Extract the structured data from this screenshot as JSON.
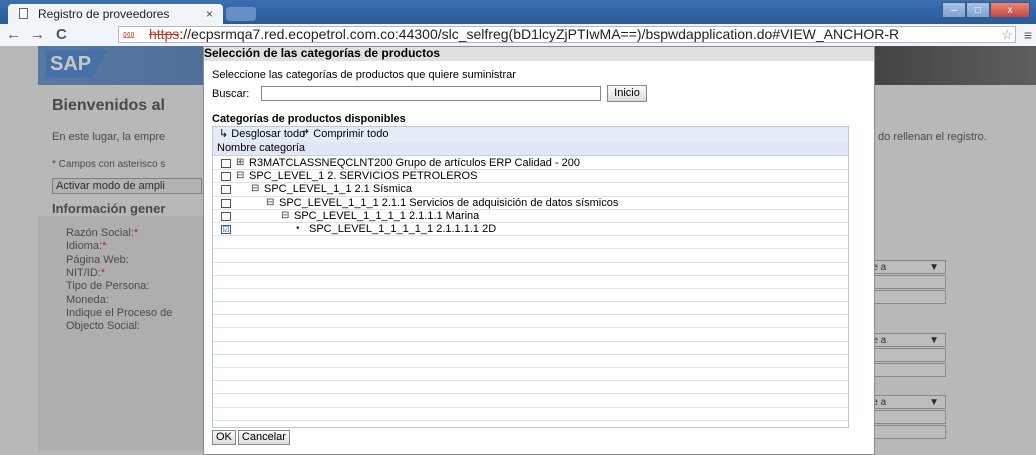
{
  "browser": {
    "tab_title": "Registro de proveedores",
    "tab_close": "×",
    "url_scheme": "https",
    "url_rest": "://ecpsrmqa7.red.ecopetrol.com.co:44300/slc_selfreg(bD1lcyZjPTIwMA==)/bspwdapplication.do#VIEW_ANCHOR-R",
    "back": "←",
    "forward": "→",
    "reload": "C",
    "menu": "≡",
    "star": "☆",
    "lock": "⅏",
    "win_min": "–",
    "win_max": "□",
    "win_close": "x"
  },
  "background": {
    "logo": "SAP",
    "heading": "Bienvenidos al",
    "intro": "En este lugar, la empre",
    "intro_right": "do rellenan el registro.",
    "required_note": "* Campos con asterisco s",
    "activar": "Activar modo de ampli",
    "info_heading": "Información gener",
    "fields": [
      "Razón Social:",
      "Idioma:",
      "Página Web:",
      "NIT/ID:",
      "Tipo de Persona:",
      "Moneda:",
      "Indique el Proceso de",
      "Objecto Social:"
    ],
    "required_marks": [
      true,
      true,
      false,
      true,
      false,
      false,
      false,
      false
    ],
    "right_selects": [
      "nte a",
      "nte a",
      "nte a"
    ],
    "select_arrow": "▼"
  },
  "modal": {
    "title": "Selección de las categorías de productos",
    "instruction": "Seleccione las categorías de productos que quiere suministrar",
    "search_label": "Buscar:",
    "search_value": "",
    "search_button": "Inicio",
    "categories_title": "Categorías de productos disponibles",
    "expand_all": "↳ Desglosar todo",
    "collapse_all": "↱ Comprimir todo",
    "column_header": "Nombre categoría",
    "rows": [
      {
        "indent": 0,
        "expander": "⊞",
        "label": "R3MATCLASSNEQCLNT200 Grupo de artículos ERP Calidad - 200",
        "checked": false
      },
      {
        "indent": 0,
        "expander": "⊟",
        "label": "SPC_LEVEL_1 2. SERVICIOS PETROLEROS",
        "checked": false
      },
      {
        "indent": 1,
        "expander": "⊟",
        "label": "SPC_LEVEL_1_1 2.1 Sísmica",
        "checked": false
      },
      {
        "indent": 2,
        "expander": "⊟",
        "label": "SPC_LEVEL_1_1_1 2.1.1 Servicios de adquisición de datos sísmicos",
        "checked": false
      },
      {
        "indent": 3,
        "expander": "⊟",
        "label": "SPC_LEVEL_1_1_1_1 2.1.1.1 Marina",
        "checked": false
      },
      {
        "indent": 4,
        "expander": "•",
        "label": "SPC_LEVEL_1_1_1_1_1 2.1.1.1.1 2D",
        "checked": true
      }
    ],
    "checked_glyph": "☑",
    "empty_rows": 15,
    "ok_button": "OK",
    "cancel_button": "Cancelar"
  }
}
